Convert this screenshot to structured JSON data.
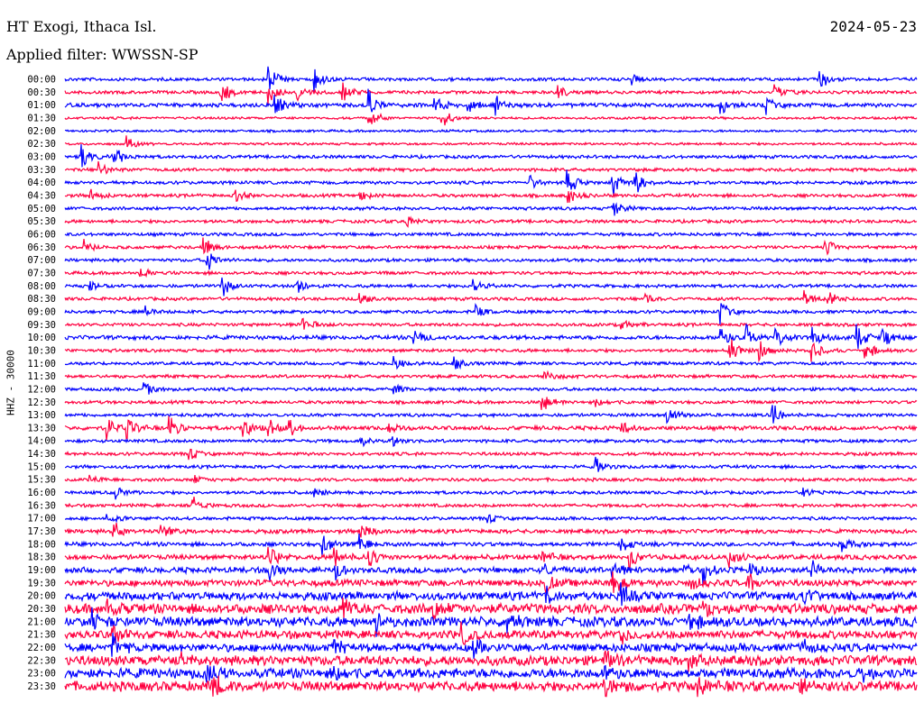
{
  "header": {
    "station": "HT Exogi, Ithaca Isl.",
    "date": "2024-05-23",
    "filter": "Applied filter: WWSSN-SP"
  },
  "chart_data": {
    "type": "line",
    "title": "HT Exogi, Ithaca Isl.",
    "ylabel": "HHZ - 30000",
    "minutes_per_line": 30,
    "colors": [
      "#0000ff",
      "#ff0040"
    ],
    "rows": [
      "00:00",
      "00:30",
      "01:00",
      "01:30",
      "02:00",
      "02:30",
      "03:00",
      "03:30",
      "04:00",
      "04:30",
      "05:00",
      "05:30",
      "06:00",
      "06:30",
      "07:00",
      "07:30",
      "08:00",
      "08:30",
      "09:00",
      "09:30",
      "10:00",
      "10:30",
      "11:00",
      "11:30",
      "12:00",
      "12:30",
      "13:00",
      "13:30",
      "14:00",
      "14:30",
      "15:00",
      "15:30",
      "16:00",
      "16:30",
      "17:00",
      "17:30",
      "18:00",
      "18:30",
      "19:00",
      "19:30",
      "20:00",
      "20:30",
      "21:00",
      "21:30",
      "22:00",
      "22:30",
      "23:00",
      "23:30"
    ],
    "noise": [
      2,
      2,
      2.5,
      1.5,
      1.5,
      1.5,
      2,
      2,
      2,
      2,
      2,
      2,
      2,
      2,
      2,
      2,
      2,
      2,
      2,
      2,
      2.5,
      2,
      2,
      2,
      2,
      2,
      2,
      2.5,
      2,
      2,
      2,
      2,
      2,
      2,
      2,
      2.5,
      2.5,
      3,
      3.5,
      4,
      5,
      6,
      6,
      5,
      5,
      6,
      6,
      6
    ],
    "events": [
      [
        [
          7.2,
          18
        ],
        [
          8.8,
          14
        ],
        [
          26.6,
          14
        ],
        [
          20,
          6
        ]
      ],
      [
        [
          5.5,
          16
        ],
        [
          7.2,
          14
        ],
        [
          8.2,
          12
        ],
        [
          9.8,
          12
        ],
        [
          17.4,
          8
        ],
        [
          25,
          10
        ]
      ],
      [
        [
          7.4,
          14
        ],
        [
          10.7,
          18
        ],
        [
          13,
          18
        ],
        [
          14.2,
          10
        ],
        [
          15.2,
          10
        ],
        [
          23.1,
          10
        ],
        [
          24.7,
          10
        ]
      ],
      [
        [
          10.7,
          16
        ],
        [
          13.3,
          14
        ]
      ],
      [],
      [
        [
          2.2,
          8
        ]
      ],
      [
        [
          0.6,
          14
        ],
        [
          1.7,
          14
        ]
      ],
      [
        [
          1.2,
          12
        ]
      ],
      [
        [
          16.4,
          8
        ],
        [
          17.7,
          18
        ],
        [
          19.3,
          18
        ],
        [
          20.1,
          14
        ]
      ],
      [
        [
          0.9,
          8
        ],
        [
          6,
          8
        ],
        [
          10.4,
          6
        ],
        [
          17.7,
          12
        ]
      ],
      [
        [
          19.3,
          12
        ]
      ],
      [
        [
          12,
          8
        ]
      ],
      [],
      [
        [
          0.7,
          8
        ],
        [
          4.9,
          14
        ],
        [
          26.8,
          10
        ]
      ],
      [
        [
          5,
          14
        ]
      ],
      [
        [
          2.6,
          10
        ]
      ],
      [
        [
          0.9,
          6
        ],
        [
          5.5,
          16
        ],
        [
          8.2,
          10
        ],
        [
          14.4,
          8
        ]
      ],
      [
        [
          10.4,
          8
        ],
        [
          20.4,
          6
        ],
        [
          26,
          12
        ],
        [
          26.9,
          10
        ]
      ],
      [
        [
          2.8,
          8
        ],
        [
          14.5,
          8
        ],
        [
          23.1,
          14
        ]
      ],
      [
        [
          8.4,
          10
        ],
        [
          19.6,
          8
        ]
      ],
      [
        [
          12.3,
          10
        ],
        [
          23.1,
          16
        ],
        [
          24,
          14
        ],
        [
          25,
          14
        ],
        [
          26.3,
          16
        ],
        [
          27.9,
          16
        ],
        [
          28.8,
          14
        ]
      ],
      [
        [
          23.4,
          16
        ],
        [
          24.4,
          14
        ],
        [
          26.3,
          16
        ],
        [
          28.2,
          14
        ]
      ],
      [
        [
          11.6,
          8
        ],
        [
          13.7,
          10
        ]
      ],
      [
        [
          16.9,
          10
        ]
      ],
      [
        [
          2.8,
          8
        ],
        [
          11.6,
          8
        ]
      ],
      [
        [
          16.8,
          12
        ],
        [
          18.7,
          8
        ]
      ],
      [
        [
          21.2,
          16
        ],
        [
          24.9,
          16
        ]
      ],
      [
        [
          1.5,
          14
        ],
        [
          2.2,
          14
        ],
        [
          3.7,
          14
        ],
        [
          6.3,
          12
        ],
        [
          7.2,
          12
        ],
        [
          7.9,
          12
        ],
        [
          11.4,
          8
        ],
        [
          19.6,
          8
        ]
      ],
      [
        [
          11.5,
          8
        ],
        [
          10.4,
          6
        ]
      ],
      [
        [
          4.4,
          8
        ]
      ],
      [
        [
          18.7,
          12
        ]
      ],
      [
        [
          0.9,
          6
        ],
        [
          4.5,
          6
        ]
      ],
      [
        [
          1.8,
          8
        ],
        [
          8.8,
          6
        ],
        [
          26,
          6
        ]
      ],
      [
        [
          4.5,
          12
        ]
      ],
      [
        [
          1.5,
          8
        ],
        [
          14.9,
          6
        ]
      ],
      [
        [
          1.7,
          12
        ],
        [
          3.4,
          12
        ],
        [
          10.4,
          12
        ]
      ],
      [
        [
          9.1,
          14
        ],
        [
          10.4,
          12
        ],
        [
          19.6,
          12
        ],
        [
          27.4,
          10
        ]
      ],
      [
        [
          7.2,
          14
        ],
        [
          9.5,
          14
        ],
        [
          10.7,
          14
        ],
        [
          16.8,
          10
        ],
        [
          19.9,
          14
        ],
        [
          23.4,
          12
        ]
      ],
      [
        [
          7.2,
          12
        ],
        [
          9.5,
          14
        ],
        [
          16.8,
          12
        ],
        [
          19.3,
          14
        ],
        [
          21.8,
          12
        ],
        [
          22.5,
          14
        ],
        [
          24.1,
          12
        ],
        [
          26.3,
          10
        ]
      ],
      [
        [
          16.9,
          14
        ],
        [
          19.3,
          14
        ],
        [
          22,
          12
        ],
        [
          24.1,
          12
        ]
      ],
      [
        [
          16.9,
          12
        ],
        [
          19.6,
          14
        ],
        [
          26,
          14
        ]
      ],
      [
        [
          1.5,
          12
        ],
        [
          9.8,
          14
        ],
        [
          13,
          12
        ],
        [
          22.5,
          10
        ]
      ],
      [
        [
          1,
          12
        ],
        [
          11,
          12
        ],
        [
          15.6,
          12
        ],
        [
          22,
          14
        ]
      ],
      [
        [
          1.7,
          12
        ],
        [
          14,
          12
        ],
        [
          19.6,
          12
        ]
      ],
      [
        [
          1.7,
          14
        ],
        [
          9.5,
          10
        ],
        [
          14.4,
          12
        ],
        [
          26,
          10
        ]
      ],
      [
        [
          4,
          12
        ],
        [
          19,
          14
        ],
        [
          22,
          12
        ]
      ],
      [
        [
          5,
          14
        ],
        [
          9.5,
          14
        ],
        [
          19,
          14
        ],
        [
          28,
          12
        ]
      ],
      [
        [
          5.2,
          16
        ],
        [
          19,
          14
        ],
        [
          22.3,
          14
        ],
        [
          25.9,
          14
        ]
      ]
    ]
  }
}
